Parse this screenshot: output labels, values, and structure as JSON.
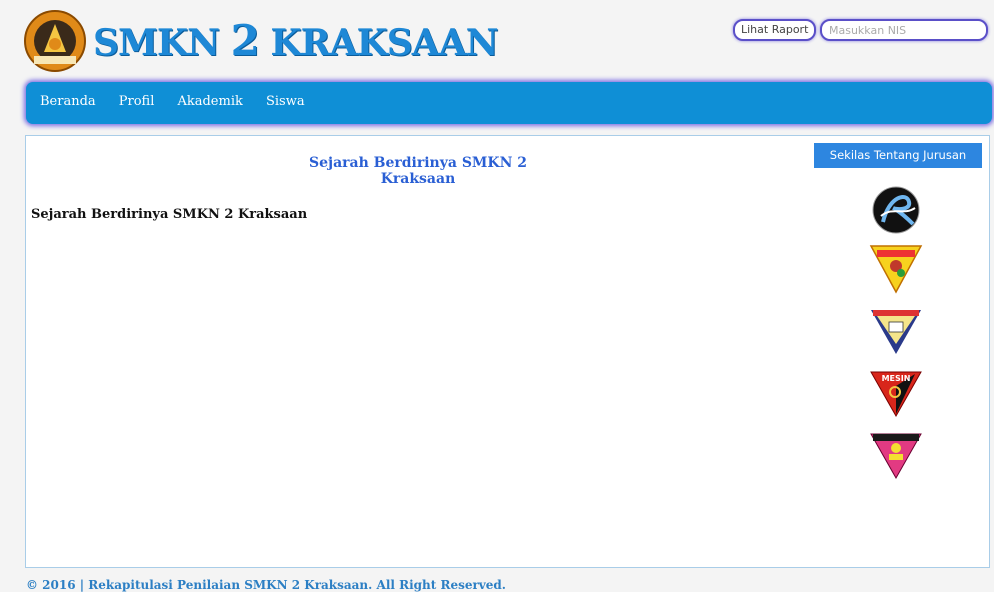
{
  "header": {
    "brand_prefix": "SMKN",
    "brand_number": "2",
    "brand_suffix": "KRAKSAAN",
    "raport_button": "Lihat Raport",
    "nis_placeholder": "Masukkan NIS"
  },
  "nav": {
    "items": [
      "Beranda",
      "Profil",
      "Akademik",
      "Siswa"
    ]
  },
  "main": {
    "title": "Sejarah Berdirinya SMKN 2 Kraksaan",
    "heading": "Sejarah Berdirinya SMKN 2 Kraksaan"
  },
  "sidebar": {
    "button": "Sekilas Tentang Jurusan",
    "jurusan_icons": [
      "rpl-logo-icon",
      "multimedia-logo-icon",
      "bangunan-logo-icon",
      "mesin-logo-icon",
      "tata-busana-logo-icon"
    ],
    "jurusan_icon_text": [
      "",
      "",
      "",
      "MESIN",
      ""
    ]
  },
  "footer": {
    "text": "© 2016 | Rekapitulasi Penilaian SMKN 2 Kraksaan. All Right Reserved."
  },
  "colors": {
    "nav_bg": "#0f8fd6",
    "brand": "#1e88d6",
    "title": "#2a5fd4",
    "button": "#2d86e0"
  }
}
